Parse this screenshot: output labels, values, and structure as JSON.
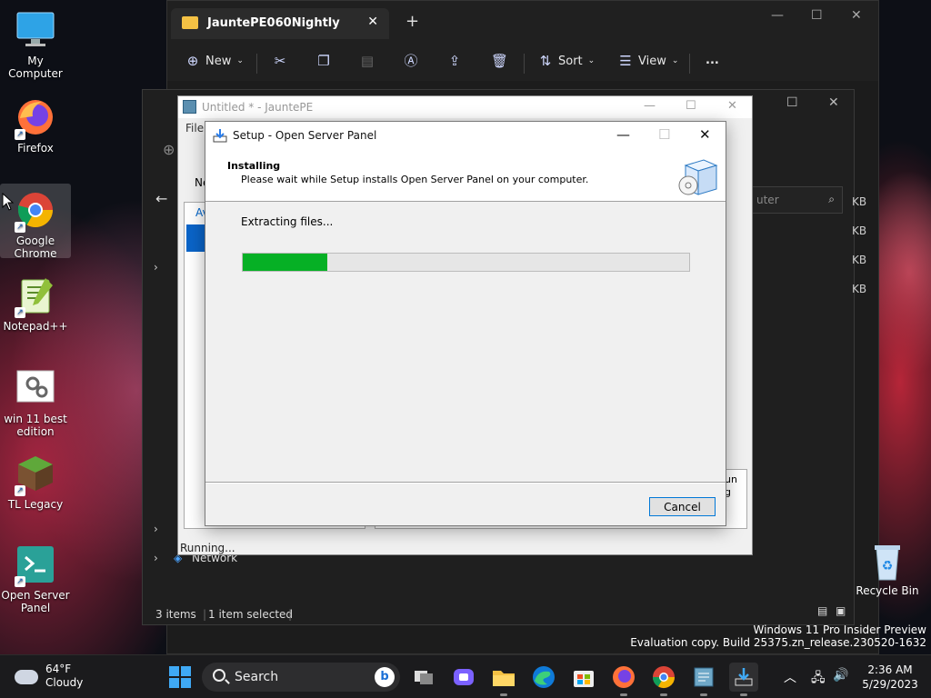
{
  "desktop": {
    "icons": [
      {
        "label": "My Computer"
      },
      {
        "label": "Firefox"
      },
      {
        "label": "Google Chrome"
      },
      {
        "label": "Notepad++"
      },
      {
        "label": "win 11 best edition"
      },
      {
        "label": "TL Legacy"
      },
      {
        "label": "Open Server Panel"
      }
    ],
    "recycle_bin": "Recycle Bin",
    "watermark_line1": "Windows 11 Pro Insider Preview",
    "watermark_line2": "Evaluation copy. Build 25375.zn_release.230520-1632"
  },
  "explorer": {
    "tab_title": "JauntePE060Nightly",
    "toolbar": {
      "new": "New",
      "sort": "Sort",
      "view": "View",
      "more": "..."
    },
    "status_items": "3 items",
    "status_selected": "1 item selected"
  },
  "back_window": {
    "search_placeholder": "uter",
    "sizes": [
      "KB",
      "KB",
      "KB",
      "KB"
    ],
    "nav_network": "Network",
    "button_fragment1": "un",
    "button_fragment2": "g"
  },
  "jaunte": {
    "title": "Untitled * - JauntePE",
    "menu_file": "File",
    "toolbar_fragment": "Ne",
    "tab_fragment": "Av",
    "status": "Running..."
  },
  "setup": {
    "title": "Setup - Open Server Panel",
    "heading": "Installing",
    "subheading": "Please wait while Setup installs Open Server Panel on your computer.",
    "status_text": "Extracting files...",
    "progress_fraction": 0.19,
    "cancel_label": "Cancel",
    "accent_color": "#06b025"
  },
  "taskbar": {
    "weather_temp": "64°F",
    "weather_desc": "Cloudy",
    "search_label": "Search",
    "time": "2:36 AM",
    "date": "5/29/2023"
  }
}
